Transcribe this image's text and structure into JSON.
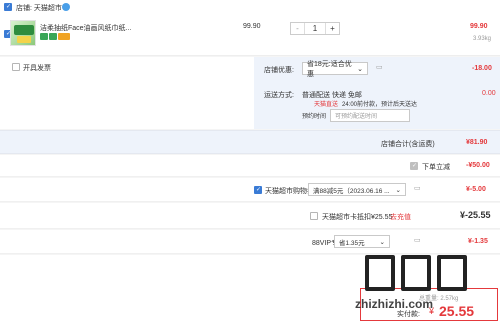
{
  "store": {
    "label": "店铺: 天猫超市",
    "badge_icon": "blue-badge-icon"
  },
  "product": {
    "title": "洁柔抽纸Face油画风纸巾纸...",
    "unit_price": "99.90",
    "quantity": "1",
    "subtotal": "99.90",
    "weight": "3.93kg",
    "minus_label": "-",
    "plus_label": "+"
  },
  "invoice": {
    "label": "开具发票"
  },
  "shop_discount": {
    "label": "店铺优惠:",
    "selected": "省18元:适合优惠",
    "amount": "-18.00"
  },
  "shipping": {
    "label": "运送方式:",
    "method": "普通配送 快递 免邮",
    "tag": "天猫直送",
    "delivery_note": "24:00前付款，预计后天送达",
    "amount": "0.00",
    "reserve_label": "预约时间",
    "reserve_placeholder": "可预约配送时间"
  },
  "store_total": {
    "label": "店铺合计(含运费)",
    "amount": "¥81.90"
  },
  "order_discount": {
    "label": "下单立减",
    "amount": "-¥50.00"
  },
  "supermarket_coupon": {
    "label": "天猫超市购物券",
    "selected": "满88减5元（2023.06.16 ...",
    "amount": "¥-5.00"
  },
  "card_pay": {
    "label": "天猫超市卡抵扣¥25.55",
    "link": "去充值",
    "amount": "¥-25.55"
  },
  "vip": {
    "label": "88VIP专享9.5折",
    "selected": "省1.35元",
    "amount": "¥-1.35"
  },
  "payment": {
    "weight": "总重量: 2.57kg",
    "pay_label": "实付款:",
    "amount": "25.55",
    "currency": "¥"
  },
  "watermark": {
    "text": "zhizhizhi.com"
  },
  "colors": {
    "accent_red": "#e4393c",
    "accent_blue": "#3a7bd5",
    "panel_blue": "#eef3fb"
  }
}
